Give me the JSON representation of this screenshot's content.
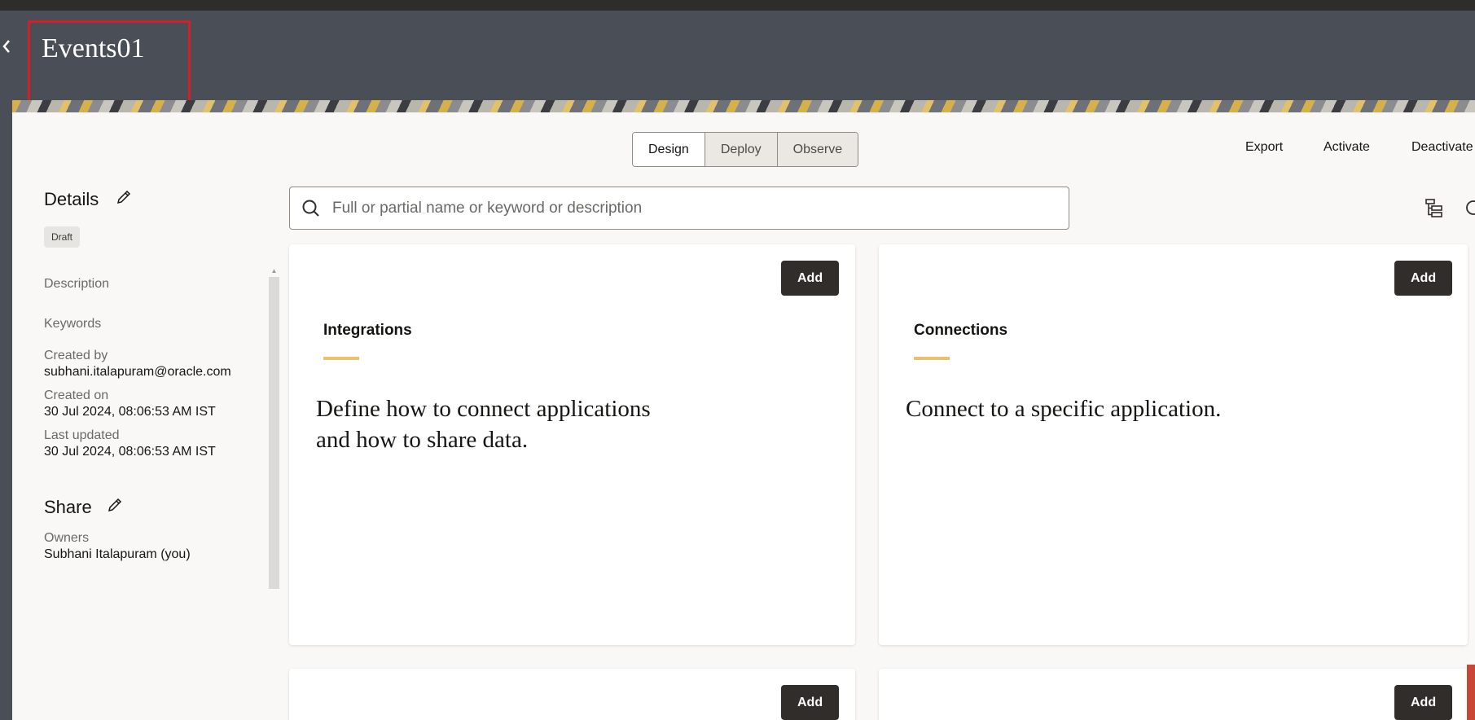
{
  "header": {
    "title": "Events01",
    "back_icon": "chevron-left-icon"
  },
  "tabs": [
    {
      "label": "Design",
      "selected": true
    },
    {
      "label": "Deploy",
      "selected": false
    },
    {
      "label": "Observe",
      "selected": false
    }
  ],
  "actions": {
    "export": "Export",
    "activate": "Activate",
    "deactivate": "Deactivate"
  },
  "sidebar": {
    "details_heading": "Details",
    "status_badge": "Draft",
    "description_label": "Description",
    "keywords_label": "Keywords",
    "created_by_label": "Created by",
    "created_by_value": "subhani.italapuram@oracle.com",
    "created_on_label": "Created on",
    "created_on_value": "30 Jul 2024, 08:06:53 AM IST",
    "last_updated_label": "Last updated",
    "last_updated_value": "30 Jul 2024, 08:06:53 AM IST",
    "share_heading": "Share",
    "owners_label": "Owners",
    "owners_value": "Subhani Italapuram (you)"
  },
  "search": {
    "placeholder": "Full or partial name or keyword or description",
    "value": ""
  },
  "cards": [
    {
      "title": "Integrations",
      "add_label": "Add",
      "description_line1": "Define how to connect applications",
      "description_line2": "and how to share data."
    },
    {
      "title": "Connections",
      "add_label": "Add",
      "description_line1": "Connect to a specific application."
    },
    {
      "add_label": "Add"
    },
    {
      "add_label": "Add"
    }
  ],
  "colors": {
    "header_bg": "#4a4e57",
    "panel_bg": "#f9f8f6",
    "highlight_border": "#d41f2a",
    "accent_bar": "#e8c26c",
    "button_bg": "#312d2a"
  }
}
